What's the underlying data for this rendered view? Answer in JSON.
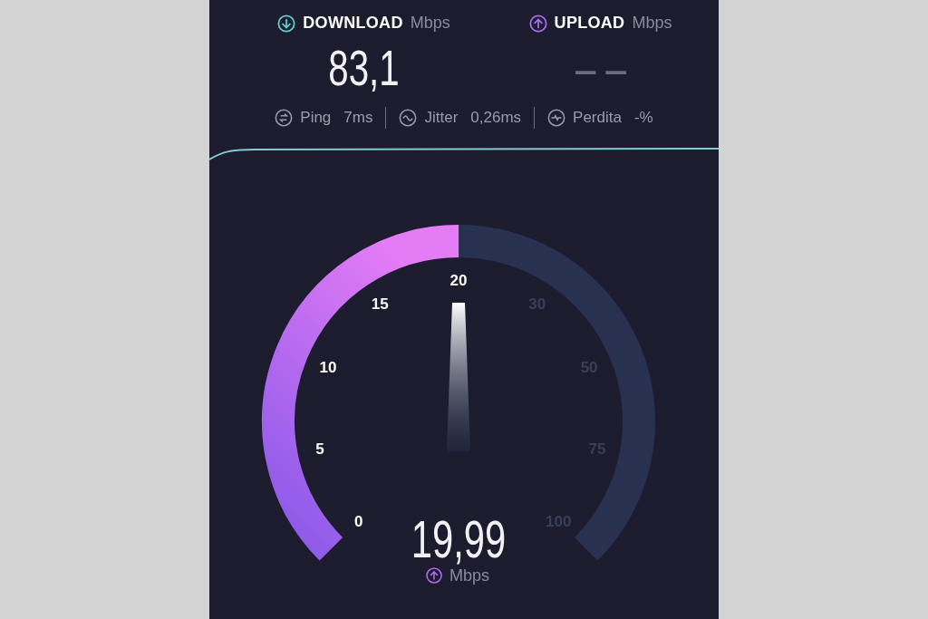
{
  "tests": [
    {
      "kind": "download",
      "label": "DOWNLOAD",
      "unit": "Mbps",
      "value": "83,1",
      "color": "#5fd0c8"
    },
    {
      "kind": "upload",
      "label": "UPLOAD",
      "unit": "Mbps",
      "value": "– –",
      "color": "#a56cf0"
    }
  ],
  "stats": [
    {
      "kind": "ping",
      "label": "Ping",
      "value": "7ms"
    },
    {
      "kind": "jitter",
      "label": "Jitter",
      "value": "0,26ms"
    },
    {
      "kind": "loss",
      "label": "Perdita",
      "value": "-%"
    }
  ],
  "gauge": {
    "ticks": [
      "0",
      "5",
      "10",
      "15",
      "20",
      "30",
      "50",
      "75",
      "100"
    ],
    "value": "19,99",
    "unit": "Mbps"
  }
}
